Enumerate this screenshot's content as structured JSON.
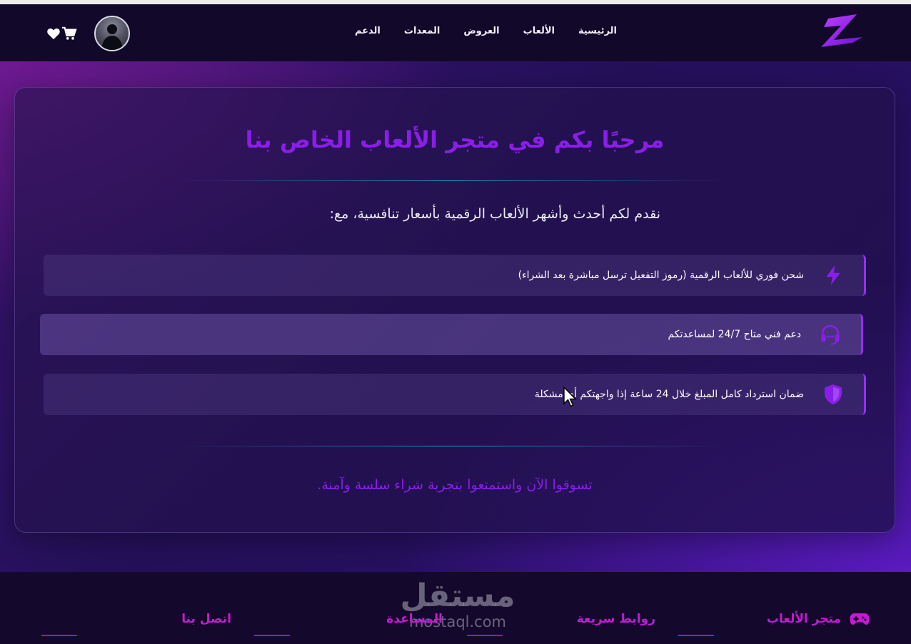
{
  "nav": {
    "links": [
      "الرئيسية",
      "الألعاب",
      "العروض",
      "المعدات",
      "الدعم"
    ]
  },
  "hero": {
    "title": "مرحبًا بكم في متجر الألعاب الخاص بنا",
    "subtitle": "نقدم لكم أحدث وأشهر الألعاب الرقمية بأسعار تنافسية، مع:",
    "features": [
      {
        "icon": "lightning-icon",
        "text": "شحن فوري للألعاب الرقمية (رموز التفعيل ترسل مباشرة بعد الشراء)"
      },
      {
        "icon": "headset-icon",
        "text": "دعم فني متاح 24/7 لمساعدتكم"
      },
      {
        "icon": "shield-icon",
        "text": "ضمان استرداد كامل المبلغ خلال 24 ساعة إذا واجهتكم أي مشكلة"
      }
    ],
    "closing": "تسوقوا الآن واستمتعوا بتجربة شراء سلسة وآمنة."
  },
  "footer": {
    "columns": [
      "متجر الألعاب",
      "روابط سريعة",
      "المساعدة",
      "اتصل بنا"
    ]
  },
  "watermark": {
    "arabic": "مستقل",
    "latin": "mostaql.com"
  },
  "colors": {
    "accent_purple": "#8a1ee8",
    "footer_heading": "#c51ad2",
    "navbar_bg": "#12082a",
    "divider_cyan": "#1f9fd0"
  }
}
